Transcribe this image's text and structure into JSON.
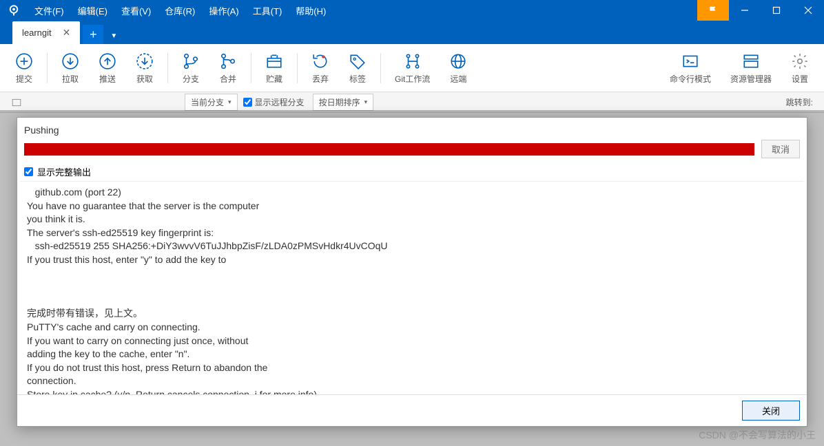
{
  "menubar": {
    "items": [
      "文件(F)",
      "编辑(E)",
      "查看(V)",
      "仓库(R)",
      "操作(A)",
      "工具(T)",
      "帮助(H)"
    ]
  },
  "tabs": {
    "active": "learngit"
  },
  "toolbar": {
    "items": [
      {
        "label": "提交",
        "icon": "plus-circle"
      },
      {
        "label": "拉取",
        "icon": "down-circle"
      },
      {
        "label": "推送",
        "icon": "up-circle"
      },
      {
        "label": "获取",
        "icon": "fetch-circle"
      },
      {
        "label": "分支",
        "icon": "branch"
      },
      {
        "label": "合并",
        "icon": "merge"
      },
      {
        "label": "贮藏",
        "icon": "stash"
      },
      {
        "label": "丢弃",
        "icon": "discard"
      },
      {
        "label": "标签",
        "icon": "tag"
      },
      {
        "label": "Git工作流",
        "icon": "gitflow"
      },
      {
        "label": "远端",
        "icon": "globe"
      },
      {
        "label": "命令行模式",
        "icon": "terminal"
      },
      {
        "label": "资源管理器",
        "icon": "explorer"
      },
      {
        "label": "设置",
        "icon": "gear"
      }
    ]
  },
  "subtoolbar": {
    "branch_dropdown": "当前分支",
    "show_remote": "显示远程分支",
    "sort_dropdown": "按日期排序",
    "goto": "跳转到:"
  },
  "dialog": {
    "title": "Pushing",
    "cancel": "取消",
    "show_full_output": "显示完整输出",
    "output": "   github.com (port 22)\nYou have no guarantee that the server is the computer\nyou think it is.\nThe server's ssh-ed25519 key fingerprint is:\n   ssh-ed25519 255 SHA256:+DiY3wvvV6TuJJhbpZisF/zLDA0zPMSvHdkr4UvCOqU\nIf you trust this host, enter \"y\" to add the key to\n\n\n\n完成时带有错误，见上文。\nPuTTY's cache and carry on connecting.\nIf you want to carry on connecting just once, without\nadding the key to the cache, enter \"n\".\nIf you do not trust this host, press Return to abandon the\nconnection.\nStore key in cache? (y/n, Return cancels connection, i for more info)",
    "close": "关闭"
  },
  "watermark": "CSDN @不会写算法的小王"
}
